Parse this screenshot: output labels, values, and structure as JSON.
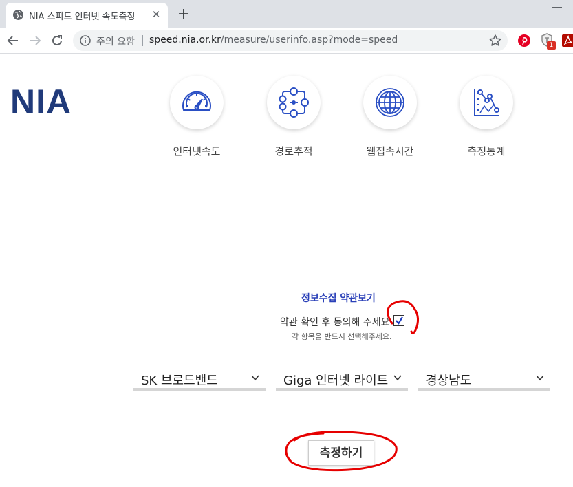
{
  "browser": {
    "tab_title": "NIA 스피드 인터넷 속도측정",
    "tab_close": "✕",
    "new_tab": "+",
    "security_label": "주의 요함",
    "url_host": "speed.nia.or.kr",
    "url_path": "/measure/userinfo.asp?mode=speed",
    "extension_badge": "1",
    "icons": [
      "globe-icon",
      "back-icon",
      "forward-icon",
      "reload-icon",
      "info-icon",
      "star-icon",
      "pinterest-icon",
      "shield-extension-icon",
      "pdf-extension-icon"
    ]
  },
  "page": {
    "logo": "NIA",
    "menu": [
      {
        "label": "인터넷속도",
        "icon": "speedometer-icon"
      },
      {
        "label": "경로추적",
        "icon": "route-icon"
      },
      {
        "label": "웹접속시간",
        "icon": "globe-grid-icon"
      },
      {
        "label": "측정통계",
        "icon": "statistics-icon"
      }
    ],
    "terms_link": "정보수집 약관보기",
    "agree_text": "약관 확인 후 동의해 주세요",
    "agree_checked": true,
    "notice": "각 항목을 반드시 선택해주세요.",
    "selects": [
      {
        "value": "SK 브로드밴드"
      },
      {
        "value": "Giga 인터넷 라이트"
      },
      {
        "value": "경상남도"
      }
    ],
    "measure_button": "측정하기"
  },
  "colors": {
    "logo": "#203a7a",
    "icon_blue": "#2a4fc4",
    "terms_link": "#2a40b8",
    "annotation_red": "#e60000"
  }
}
